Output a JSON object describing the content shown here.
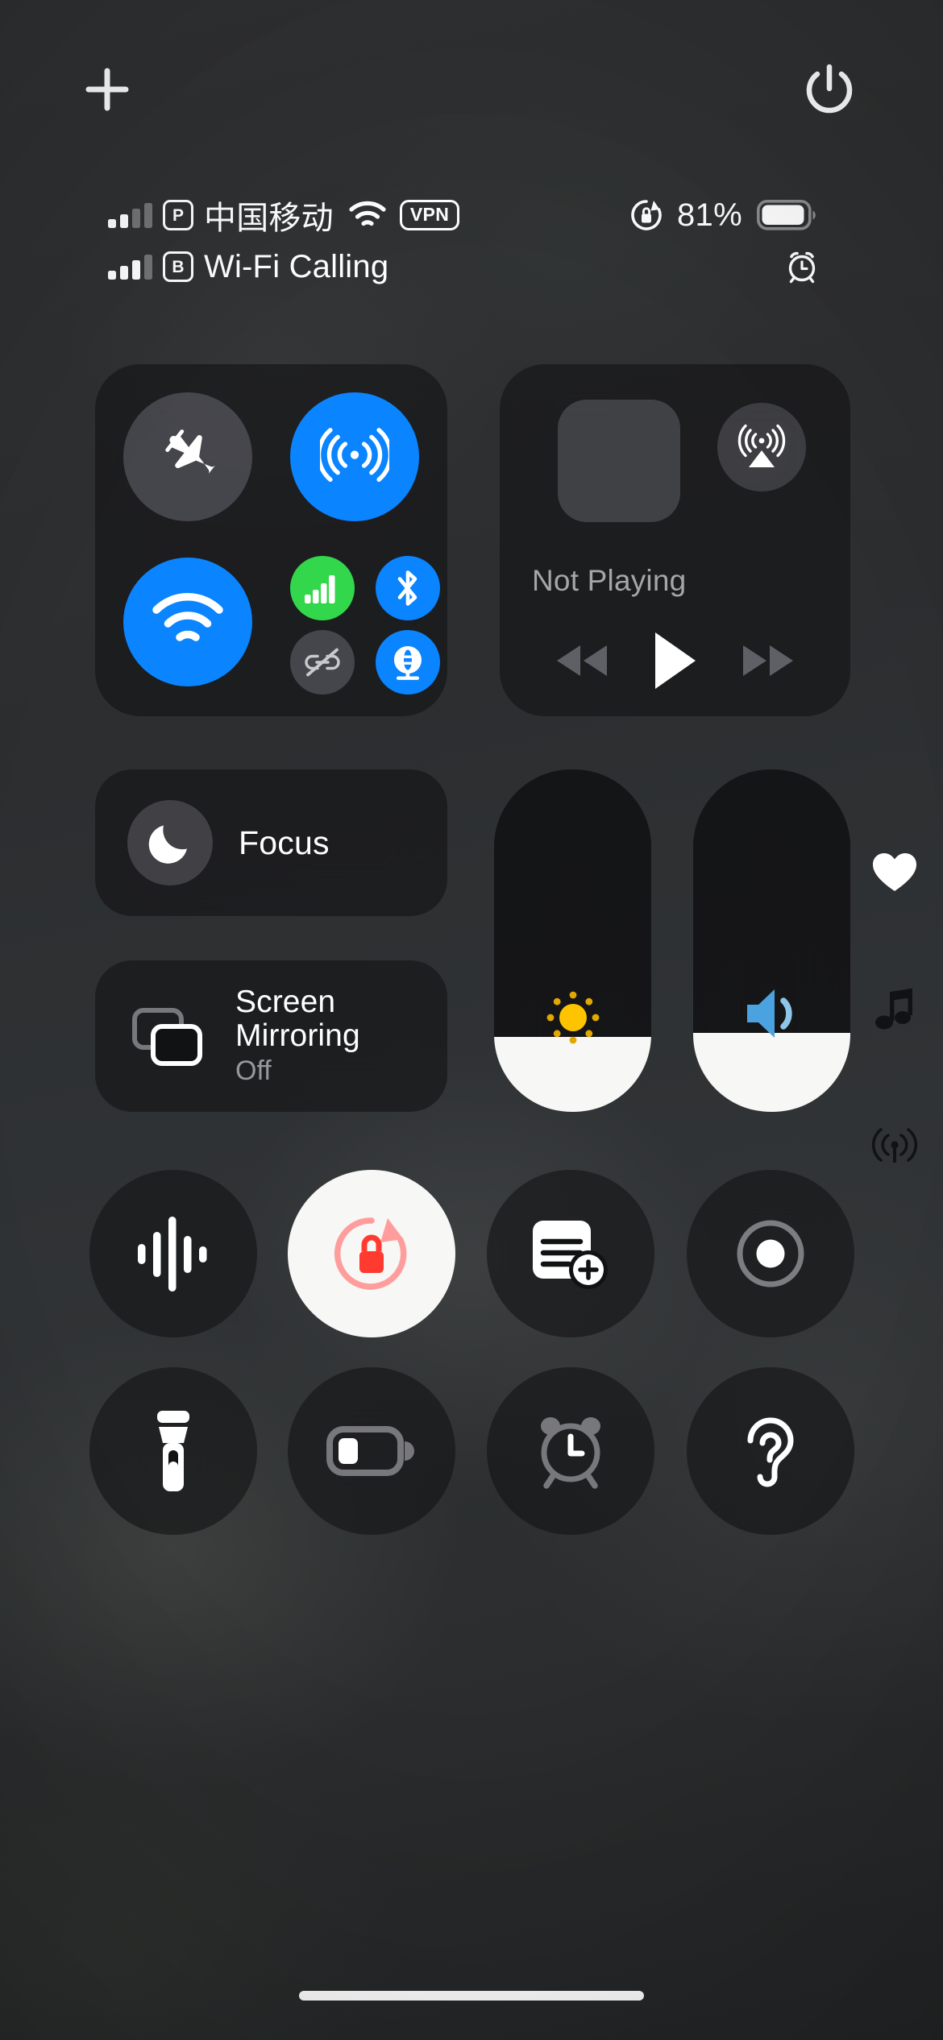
{
  "screen": {
    "name": "Control Center",
    "platform": "iOS",
    "background_color": "#2b2d2f"
  },
  "top_bar": {
    "add_button": {
      "icon": "plus-icon",
      "label": "Add"
    },
    "power_button": {
      "icon": "power-icon",
      "label": "Power Off"
    }
  },
  "status_bar": {
    "line1": {
      "signal_icon": "cellular-signal-bars",
      "signal_bars_filled": 2,
      "signal_bars_total": 4,
      "sim_badge": "P",
      "carrier": "中国移动",
      "wifi_icon": "wifi-icon",
      "vpn_badge": "VPN"
    },
    "line2": {
      "signal_icon": "cellular-signal-bars",
      "signal_bars_filled": 3,
      "signal_bars_total": 4,
      "sim_badge": "B",
      "carrier": "Wi-Fi Calling"
    },
    "right": {
      "rotation_lock_icon": "rotation-lock-icon",
      "battery_percent": "81%",
      "battery_level": 81,
      "battery_icon": "battery-icon",
      "alarm_icon": "alarm-clock-icon"
    }
  },
  "connectivity": {
    "toggles": [
      {
        "name": "airplane-mode",
        "icon": "airplane-icon",
        "state": "off",
        "color": "#76767f"
      },
      {
        "name": "airdrop",
        "icon": "airdrop-icon",
        "state": "on",
        "color": "#0a84ff"
      },
      {
        "name": "wifi",
        "icon": "wifi-icon",
        "state": "on",
        "color": "#0a84ff"
      },
      {
        "name": "cellular-data",
        "icon": "cellular-icon",
        "state": "on",
        "color": "#32d74b"
      },
      {
        "name": "bluetooth",
        "icon": "bluetooth-icon",
        "state": "on",
        "color": "#0a84ff"
      },
      {
        "name": "personal-hotspot",
        "icon": "hotspot-link-slash-icon",
        "state": "off",
        "color": "#76767f"
      },
      {
        "name": "vpn",
        "icon": "vpn-globe-icon",
        "state": "on",
        "color": "#0a84ff"
      }
    ]
  },
  "media": {
    "album_art": "album-art-placeholder",
    "airplay_icon": "airplay-audio-icon",
    "title": "Not Playing",
    "controls": [
      {
        "name": "rewind",
        "icon": "rewind-icon",
        "enabled": false
      },
      {
        "name": "play",
        "icon": "play-icon",
        "enabled": true
      },
      {
        "name": "forward",
        "icon": "fast-forward-icon",
        "enabled": false
      }
    ]
  },
  "focus": {
    "icon": "moon-icon",
    "label": "Focus",
    "state": "off"
  },
  "screen_mirroring": {
    "icon": "screen-mirroring-icon",
    "title": "Screen Mirroring",
    "status": "Off"
  },
  "sliders": [
    {
      "name": "brightness",
      "icon": "sun-icon",
      "value": 22,
      "icon_color": "#ffc400"
    },
    {
      "name": "volume",
      "icon": "speaker-icon",
      "value": 23,
      "icon_color": "#4aa3e0"
    }
  ],
  "edge_icons": [
    {
      "name": "heart-icon",
      "label": "Favorite",
      "color": "#ffffff"
    },
    {
      "name": "music-note-icon",
      "label": "Music",
      "color": "#111214"
    },
    {
      "name": "broadcast-icon",
      "label": "Broadcast",
      "color": "#111214"
    }
  ],
  "control_buttons": [
    {
      "name": "sound-recognition",
      "icon": "sound-waveform-icon",
      "state": "off",
      "row": 3,
      "col": 1
    },
    {
      "name": "rotation-lock",
      "icon": "rotation-lock-icon",
      "state": "on",
      "row": 3,
      "col": 2
    },
    {
      "name": "quick-note",
      "icon": "note-plus-icon",
      "state": "off",
      "row": 3,
      "col": 3
    },
    {
      "name": "screen-recording",
      "icon": "record-icon",
      "state": "off",
      "row": 3,
      "col": 4
    },
    {
      "name": "flashlight",
      "icon": "flashlight-icon",
      "state": "off",
      "row": 4,
      "col": 1
    },
    {
      "name": "low-power-mode",
      "icon": "battery-low-icon",
      "state": "off",
      "row": 4,
      "col": 2
    },
    {
      "name": "alarm",
      "icon": "alarm-clock-icon",
      "state": "off",
      "row": 4,
      "col": 3
    },
    {
      "name": "hearing",
      "icon": "ear-icon",
      "state": "off",
      "row": 4,
      "col": 4
    }
  ],
  "home_indicator": {
    "name": "home-indicator",
    "color": "#ffffff"
  }
}
